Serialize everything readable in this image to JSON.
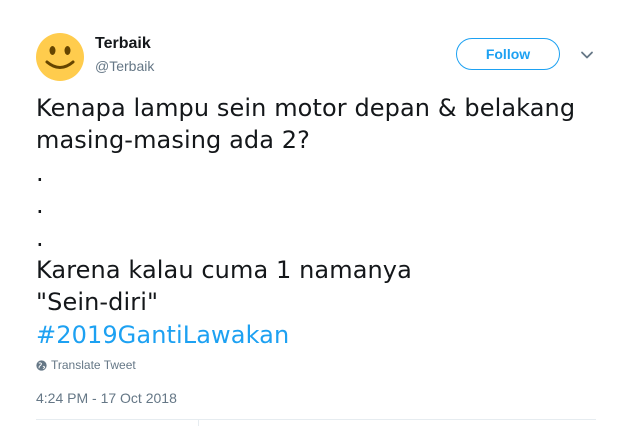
{
  "user": {
    "display_name": "Terbaik",
    "handle": "@Terbaik",
    "avatar_icon": "smiley-face-emoji-icon"
  },
  "actions": {
    "follow_label": "Follow",
    "more_icon": "chevron-down-icon"
  },
  "tweet": {
    "lines": [
      "Kenapa lampu sein motor depan & belakang",
      "masing-masing ada 2?",
      ".",
      ".",
      ".",
      "Karena kalau cuma 1 namanya",
      "\"Sein-diri\""
    ],
    "hashtag": "#2019GantiLawakan"
  },
  "translate": {
    "label": "Translate Tweet",
    "icon": "globe-icon"
  },
  "timestamp": "4:24 PM - 17 Oct 2018",
  "colors": {
    "accent": "#1da1f2",
    "text": "#14171a",
    "muted": "#657786",
    "divider": "#e6ecf0",
    "emoji_yellow": "#ffcc4d",
    "emoji_features": "#664500"
  }
}
